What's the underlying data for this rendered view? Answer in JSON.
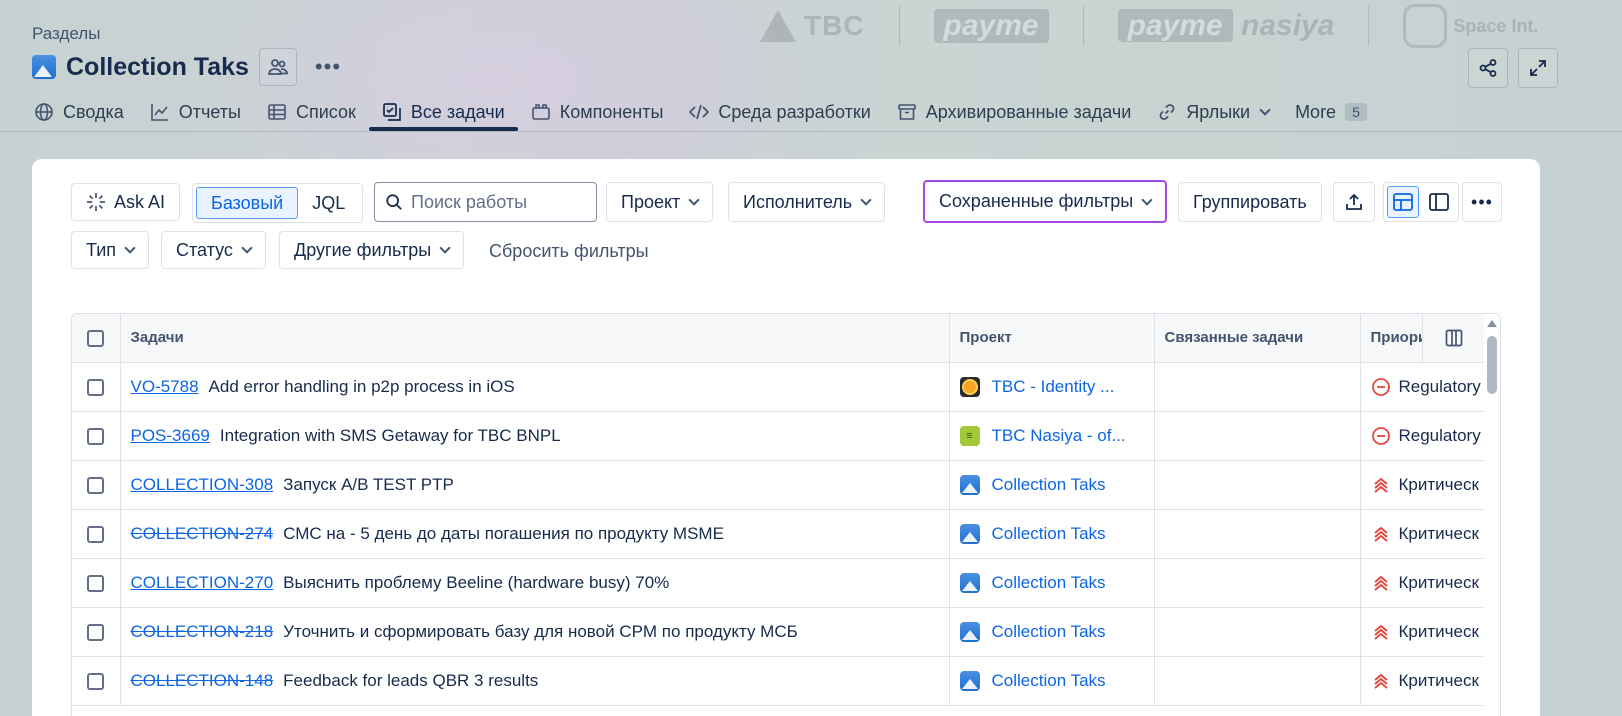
{
  "header": {
    "breadcrumb": "Разделы",
    "title": "Collection Taks"
  },
  "tabs": [
    {
      "label": "Сводка",
      "icon": "globe-icon"
    },
    {
      "label": "Отчеты",
      "icon": "chart-line-icon"
    },
    {
      "label": "Список",
      "icon": "list-table-icon"
    },
    {
      "label": "Все задачи",
      "icon": "all-tasks-icon",
      "active": true
    },
    {
      "label": "Компоненты",
      "icon": "components-icon"
    },
    {
      "label": "Среда разработки",
      "icon": "code-icon"
    },
    {
      "label": "Архивированные задачи",
      "icon": "archive-icon"
    },
    {
      "label": "Ярлыки",
      "icon": "link-icon"
    },
    {
      "label": "More",
      "badge": "5"
    }
  ],
  "toolbar": {
    "ask_ai": "Ask AI",
    "mode_basic": "Базовый",
    "mode_jql": "JQL",
    "search_placeholder": "Поиск работы",
    "project": "Проект",
    "assignee": "Исполнитель",
    "saved_filters": "Сохраненные фильтры",
    "group": "Группировать",
    "type": "Тип",
    "status": "Статус",
    "other_filters": "Другие фильтры",
    "reset": "Сбросить фильтры"
  },
  "table": {
    "columns": [
      "Задачи",
      "Проект",
      "Связанные задачи",
      "Приори"
    ],
    "rows": [
      {
        "key": "VO-5788",
        "done": false,
        "summary": "Add error handling in p2p process in iOS",
        "project": "TBC - Identity ...",
        "project_icon": "identity",
        "priority": "Regulatory",
        "priority_icon": "regulatory"
      },
      {
        "key": "POS-3669",
        "done": false,
        "summary": "Integration with SMS Getaway for TBC BNPL",
        "project": "TBC Nasiya - of...",
        "project_icon": "nasiya",
        "priority": "Regulatory",
        "priority_icon": "regulatory"
      },
      {
        "key": "COLLECTION-308",
        "done": false,
        "summary": "Запуск A/B TEST PTP",
        "project": "Collection Taks",
        "project_icon": "collection",
        "priority": "Критическ",
        "priority_icon": "critical"
      },
      {
        "key": "COLLECTION-274",
        "done": true,
        "summary": "СМС на - 5 день до даты погашения по продукту MSME",
        "project": "Collection Taks",
        "project_icon": "collection",
        "priority": "Критическ",
        "priority_icon": "critical"
      },
      {
        "key": "COLLECTION-270",
        "done": false,
        "summary": "Выяснить проблему Beeline (hardware busy) 70%",
        "project": "Collection Taks",
        "project_icon": "collection",
        "priority": "Критическ",
        "priority_icon": "critical"
      },
      {
        "key": "COLLECTION-218",
        "done": true,
        "summary": "Уточнить и сформировать базу для новой CPM по продукту МСБ",
        "project": "Collection Taks",
        "project_icon": "collection",
        "priority": "Критическ",
        "priority_icon": "critical"
      },
      {
        "key": "COLLECTION-148",
        "done": true,
        "summary": "Feedback for leads QBR 3 results",
        "project": "Collection Taks",
        "project_icon": "collection",
        "priority": "Критическ",
        "priority_icon": "critical"
      }
    ]
  },
  "colors": {
    "link": "#0c66e4",
    "saved_filter_border": "#a54ae0",
    "priority_red": "#e2483d"
  }
}
